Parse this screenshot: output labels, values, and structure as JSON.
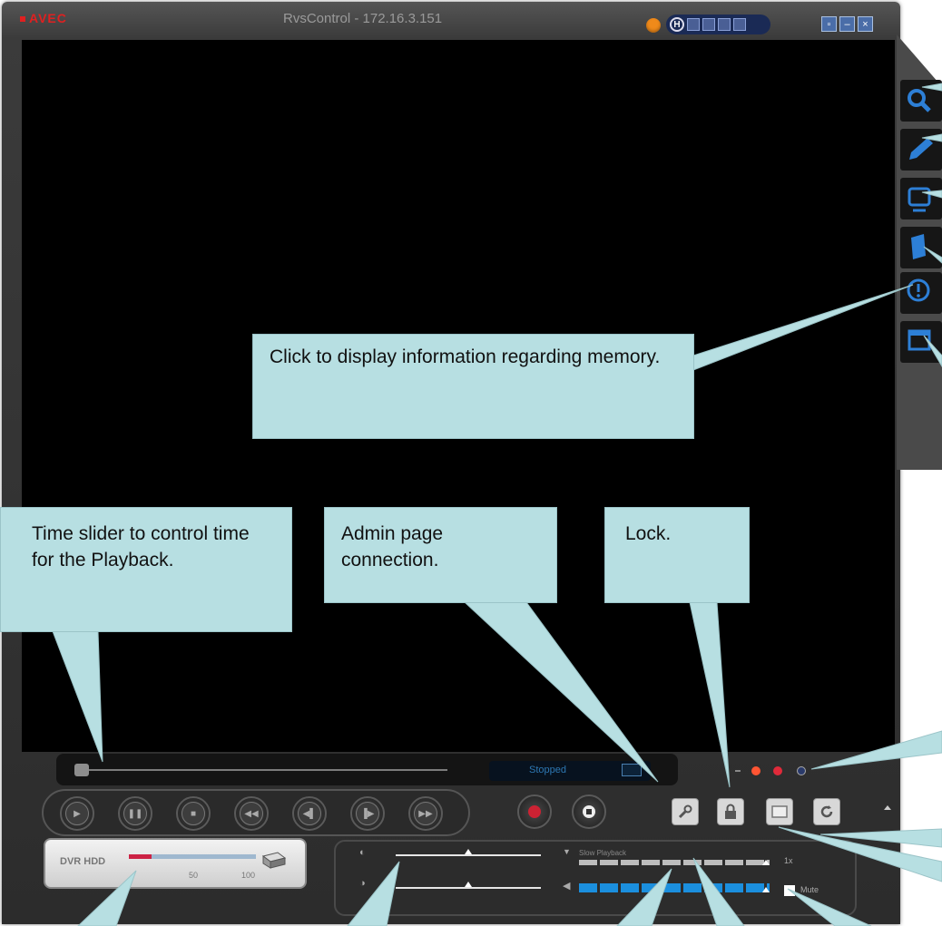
{
  "app": {
    "logo": "AVEC",
    "title": "RvsControl - 172.16.3.151",
    "pager_mode": "H"
  },
  "timeline": {
    "status": "Stopped"
  },
  "hdd": {
    "label": "DVR HDD",
    "tick_50": "50",
    "tick_100": "100",
    "used_fraction": 0.18
  },
  "controls": {
    "slow_playback_label": "Slow Playback",
    "speed_value": "1x",
    "mute_label": "Mute"
  },
  "callouts": {
    "memory": "Click to display information regarding memory.",
    "time_slider": "Time slider to control time for the Playback.",
    "admin": "Admin page connection.",
    "lock": "Lock."
  },
  "colors": {
    "callout_bg": "#b7dfe2",
    "record_red": "#cc2233",
    "accent_blue": "#1b8fde"
  },
  "icons": {
    "sidebar": [
      "search-icon",
      "pen-icon",
      "monitor-icon",
      "document-icon",
      "info-icon",
      "window-icon"
    ],
    "transport": [
      "play-icon",
      "pause-icon",
      "stop-icon",
      "rewind-icon",
      "step-back-icon",
      "step-forward-icon",
      "fast-forward-icon"
    ]
  }
}
